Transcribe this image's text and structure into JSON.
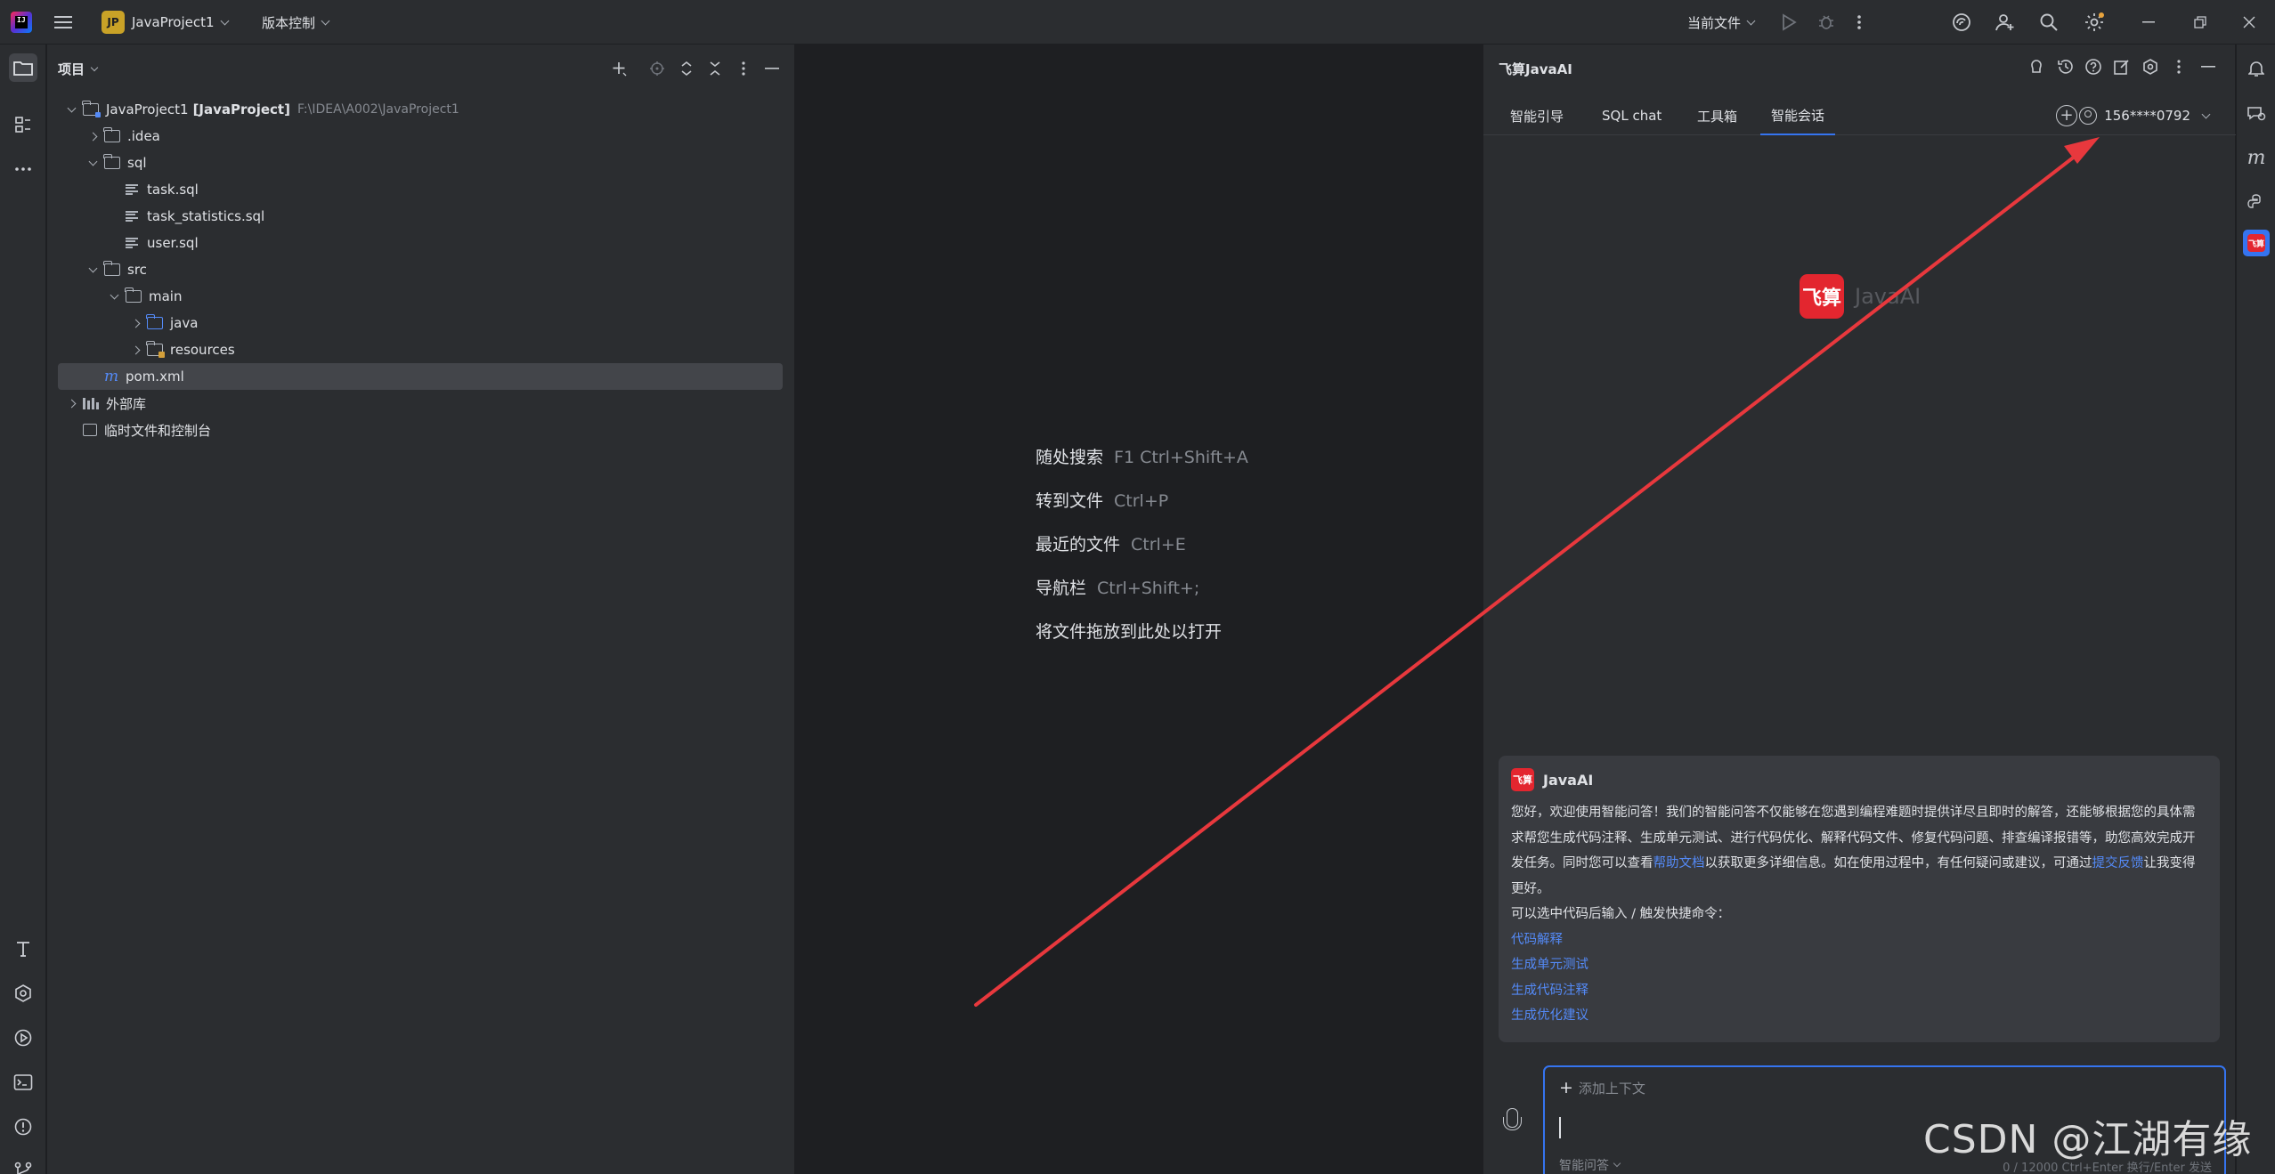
{
  "titlebar": {
    "logo_text": "IJ",
    "project_badge": "JP",
    "project_name": "JavaProject1",
    "vcs_label": "版本控制",
    "run_config": "当前文件"
  },
  "project_panel": {
    "title": "项目",
    "tree": [
      {
        "label": "JavaProject1",
        "bold": "[JavaProject]",
        "path": "F:\\IDEA\\A002\\JavaProject1"
      },
      {
        "label": ".idea"
      },
      {
        "label": "sql"
      },
      {
        "label": "task.sql"
      },
      {
        "label": "task_statistics.sql"
      },
      {
        "label": "user.sql"
      },
      {
        "label": "src"
      },
      {
        "label": "main"
      },
      {
        "label": "java"
      },
      {
        "label": "resources"
      },
      {
        "label": "pom.xml"
      },
      {
        "label": "外部库"
      },
      {
        "label": "临时文件和控制台"
      }
    ]
  },
  "editor": {
    "hints": [
      {
        "label": "随处搜索",
        "keys": "F1 Ctrl+Shift+A"
      },
      {
        "label": "转到文件",
        "keys": "Ctrl+P"
      },
      {
        "label": "最近的文件",
        "keys": "Ctrl+E"
      },
      {
        "label": "导航栏",
        "keys": "Ctrl+Shift+;"
      },
      {
        "label": "将文件拖放到此处以打开",
        "keys": ""
      }
    ]
  },
  "ai_panel": {
    "title": "飞算JavaAI",
    "tabs": [
      "智能引导",
      "SQL chat",
      "工具箱",
      "智能会话"
    ],
    "user": "156****0792",
    "brand_badge": "飞算",
    "brand_text": "JavaAI",
    "card": {
      "badge": "飞算",
      "name": "JavaAI",
      "p1": "您好，欢迎使用智能问答！我们的智能问答不仅能够在您遇到编程难题时提供详尽且即时的解答，还能够根据您的具体需求帮您生成代码注释、生成单元测试、进行代码优化、解释代码文件、修复代码问题、排查编译报错等，助您高效完成开发任务。同时您可以查看",
      "link1": "帮助文档",
      "p2": "以获取更多详细信息。如在使用过程中，有任何疑问或建议，可通过",
      "link2": "提交反馈",
      "p3": "让我变得更好。",
      "p4": "可以选中代码后输入 / 触发快捷命令：",
      "commands": [
        "代码解释",
        "生成单元测试",
        "生成代码注释",
        "生成优化建议"
      ]
    },
    "input": {
      "add_context": "添加上下文",
      "mode": "智能问答",
      "counter": "0 / 12000   Ctrl+Enter 换行/Enter 发送"
    }
  },
  "right_strip": {
    "feisuan_badge": "飞算"
  },
  "watermark": "CSDN @江湖有缘",
  "colors": {
    "accent": "#3574f0",
    "brand_red": "#e3262f",
    "annotation_arrow": "#e8383d",
    "link": "#548af7"
  }
}
